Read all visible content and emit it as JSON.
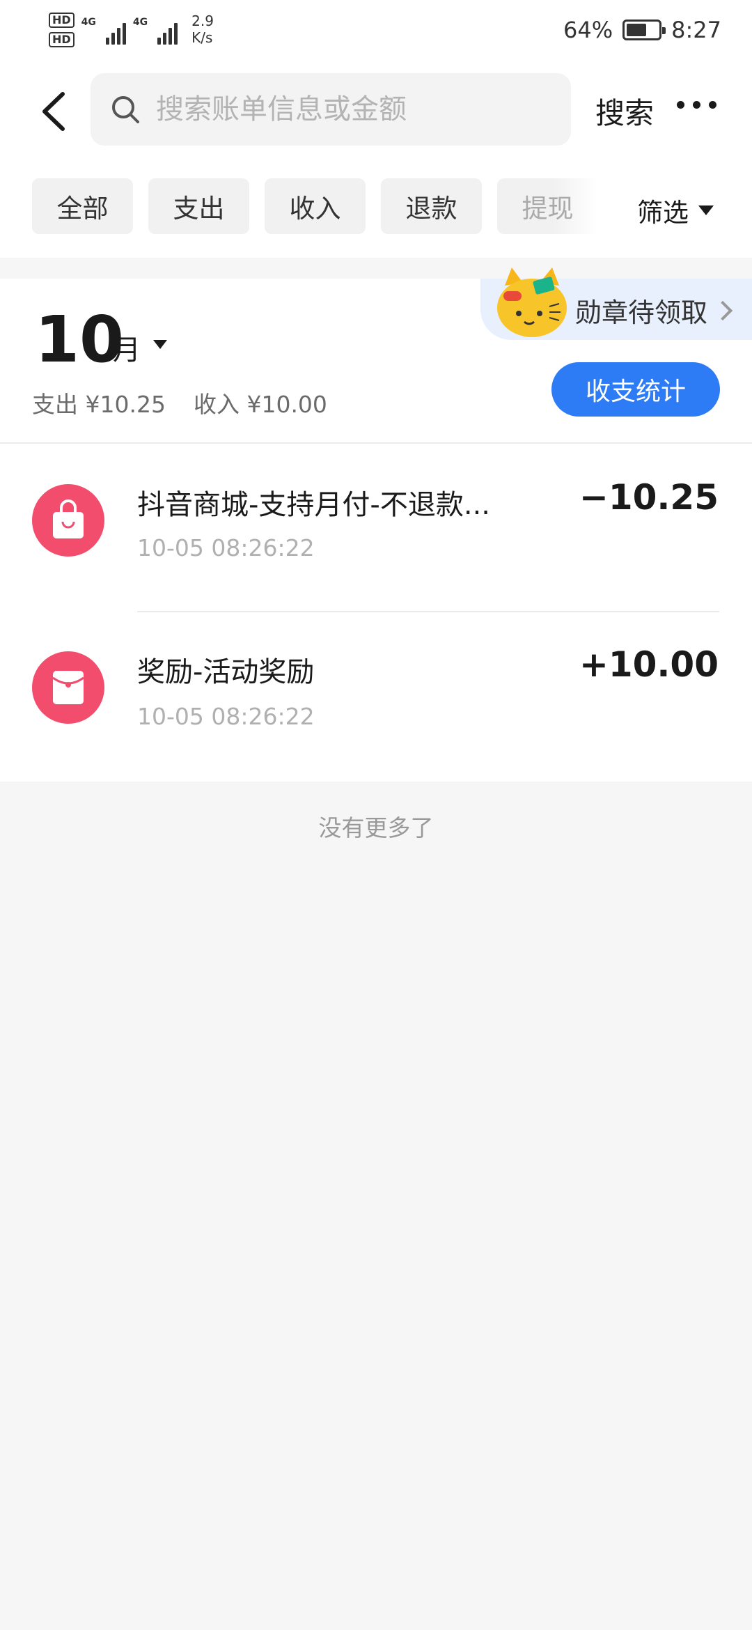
{
  "status_bar": {
    "hd1": "HD",
    "hd2": "HD",
    "net1": "4G",
    "net2": "4G",
    "speed_value": "2.9",
    "speed_unit": "K/s",
    "battery_pct": "64%",
    "battery_level": 0.64,
    "time": "8:27"
  },
  "header": {
    "search_placeholder": "搜索账单信息或金额",
    "search_label": "搜索"
  },
  "filters": {
    "chips": [
      "全部",
      "支出",
      "收入",
      "退款",
      "提现"
    ],
    "filter_label": "筛选"
  },
  "month": {
    "number": "10",
    "unit": "月",
    "expense": "支出 ¥10.25",
    "income": "收入 ¥10.00",
    "stats_button": "收支统计",
    "badge_text": "勋章待领取"
  },
  "transactions": [
    {
      "title": "抖音商城-支持月付-不退款...",
      "time": "10-05 08:26:22",
      "amount": "−10.25",
      "icon": "shopping-bag-icon"
    },
    {
      "title": "奖励-活动奖励",
      "time": "10-05 08:26:22",
      "amount": "+10.00",
      "icon": "red-envelope-icon"
    }
  ],
  "footer": {
    "no_more": "没有更多了"
  },
  "colors": {
    "accent_blue": "#2e7bf6",
    "icon_red": "#f24d6d",
    "badge_bg": "#e8f0fd",
    "page_bg": "#f6f6f6"
  }
}
